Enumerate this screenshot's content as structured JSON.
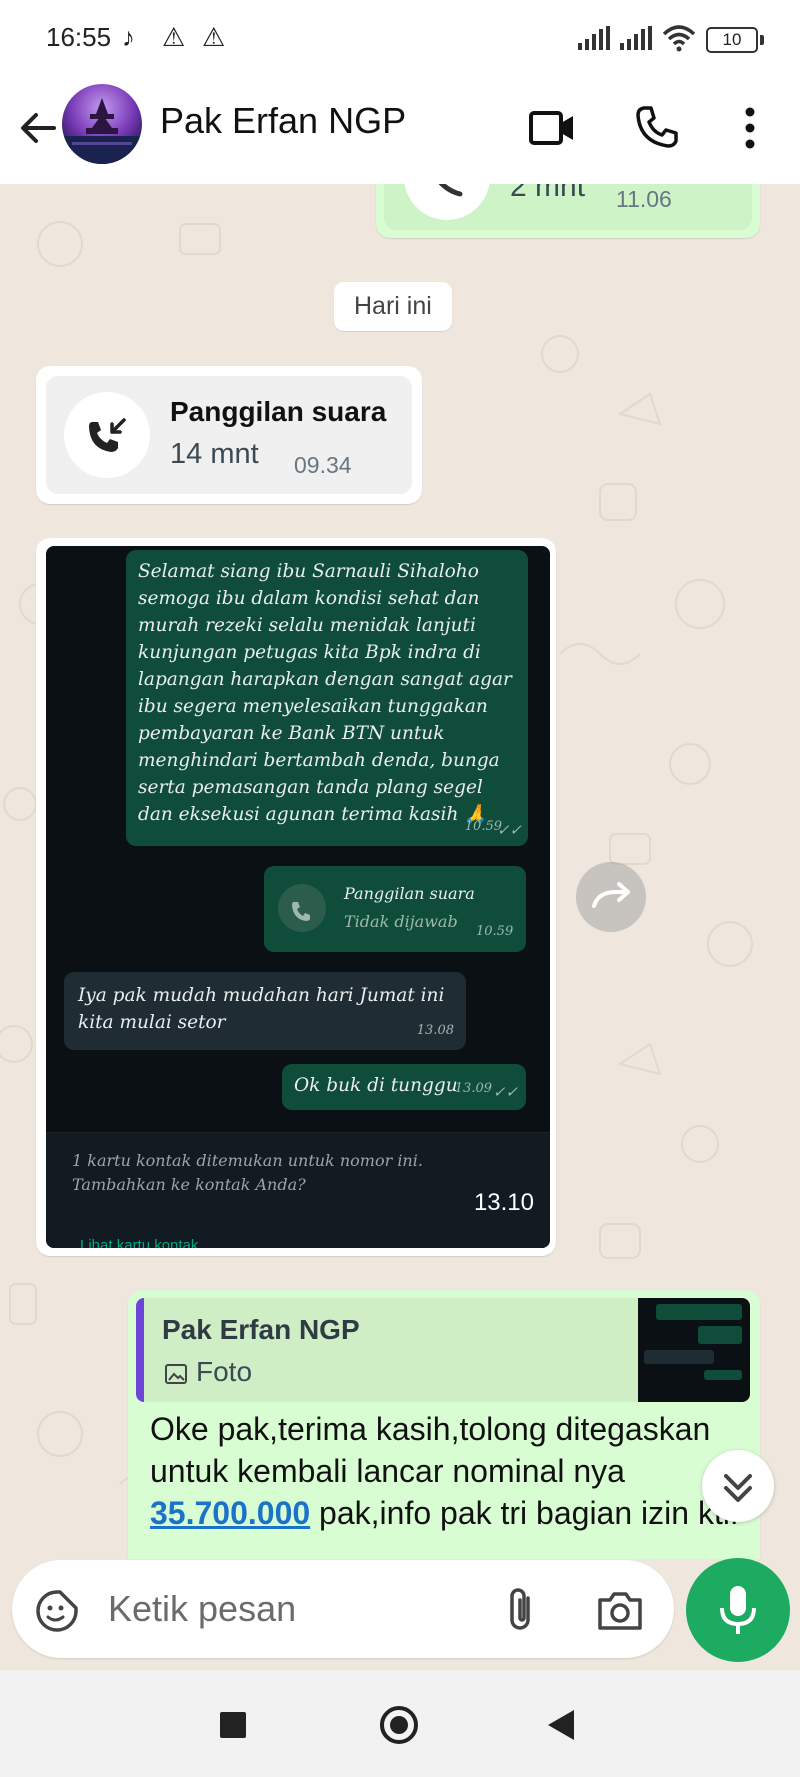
{
  "status_bar": {
    "time": "16:55",
    "battery": "10"
  },
  "header": {
    "contact_name": "Pak Erfan NGP"
  },
  "chat": {
    "prev_call": {
      "duration": "2 mnt",
      "time": "11.06"
    },
    "day_chip": "Hari ini",
    "incoming_call": {
      "title": "Panggilan suara",
      "duration": "14 mnt",
      "time": "09.34"
    },
    "image_message": {
      "time": "13.10",
      "inner": {
        "msg1": "Selamat siang ibu Sarnauli Sihaloho semoga ibu dalam kondisi sehat dan murah rezeki selalu menidak lanjuti kunjungan petugas kita Bpk indra di lapangan harapkan dengan sangat agar ibu segera menyelesaikan tunggakan pembayaran ke Bank BTN untuk menghindari bertambah denda, bunga serta pemasangan tanda plang segel dan eksekusi agunan terima kasih 🙏",
        "msg1_time": "10.59",
        "call_title": "Panggilan suara",
        "call_status": "Tidak dijawab",
        "call_time": "10.59",
        "msg2": "Iya pak mudah mudahan hari Jumat ini kita mulai setor",
        "msg2_time": "13.08",
        "msg3": "Ok buk di tunggu",
        "msg3_time": "13.09",
        "footer_note": "1 kartu kontak ditemukan untuk nomor ini. Tambahkan ke kontak Anda?",
        "footer_link": "Lihat kartu kontak"
      }
    },
    "reply_message": {
      "quoted_name": "Pak Erfan NGP",
      "quoted_type": "Foto",
      "text_before": "Oke pak,terima kasih,tolong ditegaskan untuk kembali lancar nominal nya ",
      "amount_link": "35.700.000",
      "text_after": " pak,info pak tri bagian izin ktif"
    }
  },
  "composer": {
    "placeholder": "Ketik pesan"
  },
  "colors": {
    "accent": "#1daa61",
    "outgoing": "#d9fdd3",
    "incoming": "#ffffff",
    "quote_bar": "#6e45d9",
    "link": "#1a73c8"
  },
  "icons": [
    "back-arrow-icon",
    "video-call-icon",
    "phone-icon",
    "more-icon",
    "missed-call-icon",
    "incoming-call-icon",
    "forward-icon",
    "scroll-down-icon",
    "sticker-icon",
    "attach-icon",
    "camera-icon",
    "mic-icon",
    "nav-square-icon",
    "nav-home-icon",
    "nav-back-icon"
  ]
}
